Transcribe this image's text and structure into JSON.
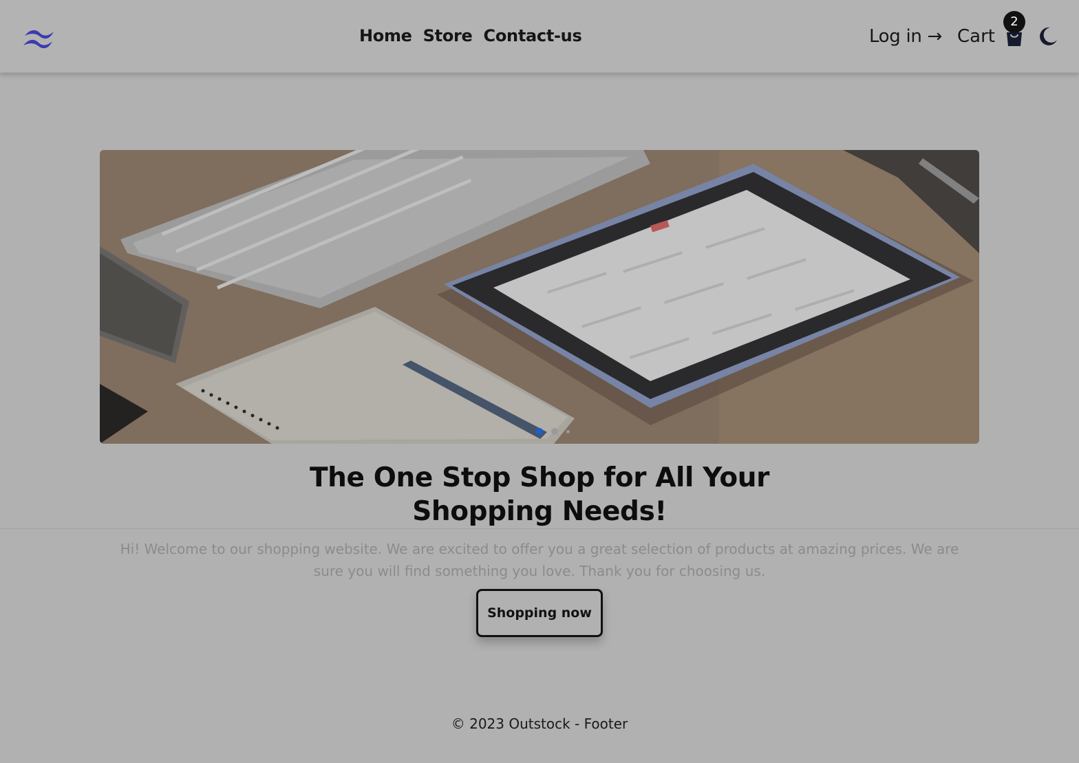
{
  "header": {
    "logo_icon": "wave-logo-icon",
    "nav": [
      {
        "label": "Home"
      },
      {
        "label": "Store"
      },
      {
        "label": "Contact-us"
      }
    ],
    "login_label": "Log in →",
    "cart_label": "Cart",
    "cart_icon": "shopping-bag-icon",
    "cart_count": "2",
    "theme_icon": "moon-icon"
  },
  "carousel": {
    "slides": 3,
    "active_slide": 1
  },
  "hero": {
    "title_line1": "The One Stop Shop for All Your",
    "title_line2": "Shopping Needs!",
    "description": "Hi! Welcome to our shopping website. We are excited to offer you a great selection of products at amazing prices. We are sure you will find something you love. Thank you for choosing us.",
    "button_label": "Shopping now"
  },
  "footer": {
    "text": "© 2023 Outstock - Footer"
  },
  "colors": {
    "logo": "#3b3bb0",
    "background": "#b1b1b1",
    "active_dot": "#1a5fd0"
  }
}
